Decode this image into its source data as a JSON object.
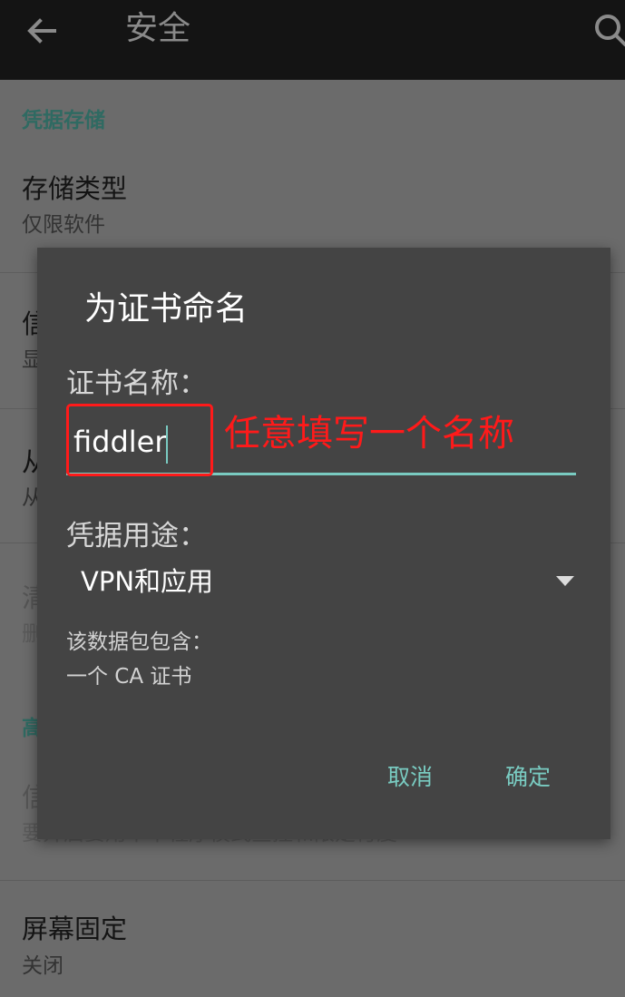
{
  "appbar": {
    "back_icon": "arrow-back-icon",
    "title": "安全",
    "search_icon": "search-icon"
  },
  "settings": {
    "credential_storage_header": "凭据存储",
    "storage_type": {
      "title": "存储类型",
      "summary": "仅限软件"
    },
    "partial_row_1": {
      "title": "信",
      "summary": "显"
    },
    "partial_row_2": {
      "title": "从",
      "summary": "从"
    },
    "partial_row_3": {
      "title": "清",
      "summary": "删"
    },
    "advanced_header_partial": "高",
    "partial_row_4": {
      "title": "信",
      "summary": "要开启要用不本程序模式查控和限定付度"
    },
    "screen_pinning": {
      "title": "屏幕固定",
      "summary": "关闭"
    }
  },
  "dialog": {
    "title": "为证书命名",
    "cert_name_label": "证书名称：",
    "cert_name_value": "fiddler",
    "annotation": "任意填写一个名称",
    "usage_label": "凭据用途：",
    "usage_value": "VPN和应用",
    "package_contains_label": "该数据包包含：",
    "package_contents": "一个 CA 证书",
    "cancel_label": "取消",
    "ok_label": "确定"
  },
  "colors": {
    "accent": "#79cbc1",
    "annotation_red": "#ff1a1a",
    "dialog_bg": "#444444",
    "appbar_bg": "#141414"
  }
}
